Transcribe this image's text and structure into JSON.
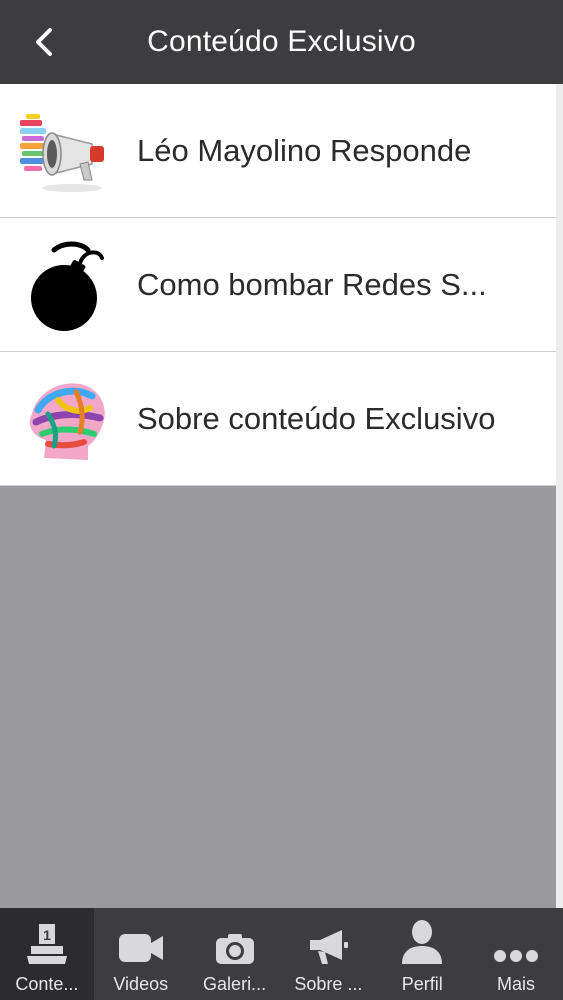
{
  "header": {
    "title": "Conteúdo Exclusivo",
    "back_icon": "chevron-left-icon"
  },
  "list": {
    "items": [
      {
        "label": "Léo Mayolino Responde",
        "icon": "megaphone-thumbnail"
      },
      {
        "label": "Como bombar Redes S...",
        "icon": "bomb-thumbnail"
      },
      {
        "label": "Sobre conteúdo Exclusivo",
        "icon": "colorful-head-thumbnail"
      }
    ]
  },
  "tabbar": {
    "active_index": 0,
    "items": [
      {
        "label": "Conte...",
        "icon": "podium-icon",
        "badge": "1"
      },
      {
        "label": "Videos",
        "icon": "video-camera-icon"
      },
      {
        "label": "Galeri...",
        "icon": "camera-icon"
      },
      {
        "label": "Sobre ...",
        "icon": "megaphone-icon"
      },
      {
        "label": "Perfil",
        "icon": "person-icon"
      },
      {
        "label": "Mais",
        "icon": "more-dots-icon"
      }
    ]
  },
  "colors": {
    "bar": "#3d3d3f",
    "active_tab": "#2c2c2e",
    "background": "#9a999e",
    "row": "#ffffff",
    "text": "#2b2b2d"
  }
}
